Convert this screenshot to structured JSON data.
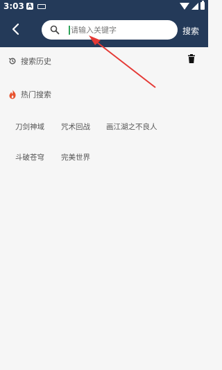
{
  "status_bar": {
    "time": "3:03",
    "a_icon_letter": "A"
  },
  "header": {
    "back_icon": "chevron-left-icon",
    "search_placeholder": "请输入关键字",
    "search_value": "",
    "search_button_label": "搜索"
  },
  "history": {
    "title": "搜索历史",
    "icon": "history-icon",
    "delete_icon": "trash-icon"
  },
  "hot": {
    "title": "热门搜索",
    "icon": "flame-icon",
    "tags": [
      "刀剑神域",
      "咒术回战",
      "画江湖之不良人",
      "斗破苍穹",
      "完美世界"
    ]
  },
  "colors": {
    "header_bg": "#243a59",
    "page_bg": "#f6f6f6",
    "accent_flame": "#e8532f",
    "annotation_arrow": "#e53935"
  }
}
